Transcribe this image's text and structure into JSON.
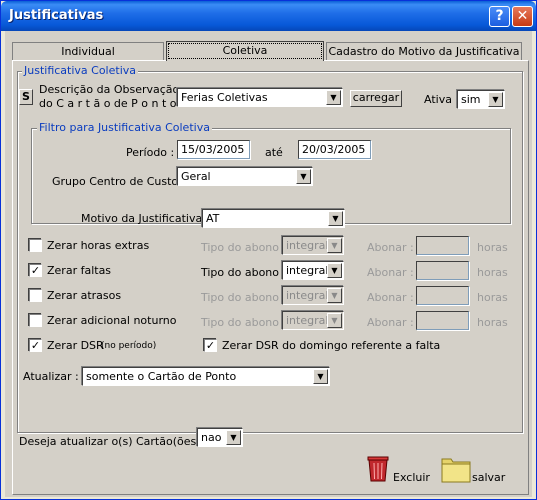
{
  "window": {
    "title": "Justificativas",
    "help_label": "?",
    "close_label": "✕"
  },
  "tabs": [
    {
      "label": "Individual"
    },
    {
      "label": "Coletiva"
    },
    {
      "label": "Cadastro do Motivo da Justificativa"
    }
  ],
  "justificativa_coletiva": {
    "legend": "Justificativa Coletiva",
    "s_icon_label": "S",
    "descricao_label_line1": "Descrição da Observação",
    "descricao_label_line2": "do C a r t ã o  de  P o n t o :",
    "descricao_value": "Ferias Coletivas",
    "carregar_label": "carregar",
    "ativa_label": "Ativa :",
    "ativa_value": "sim"
  },
  "filtro": {
    "legend": "Filtro para Justificativa Coletiva",
    "periodo_label": "Período :",
    "periodo_inicio": "15/03/2005",
    "ate_label": "até",
    "periodo_fim": "20/03/2005",
    "grupo_label": "Grupo Centro de Custo :",
    "grupo_value": "Geral"
  },
  "motivo": {
    "label": "Motivo da Justificativa :",
    "value": "AT"
  },
  "rows": [
    {
      "label": "Zerar horas extras",
      "checked": false,
      "enabled": false,
      "tipo_label": "Tipo do abono :",
      "tipo_value": "integral",
      "abonar_label": "Abonar :",
      "abonar_value": "",
      "horas_label": "horas"
    },
    {
      "label": "Zerar faltas",
      "checked": true,
      "enabled": true,
      "tipo_label": "Tipo do abono :",
      "tipo_value": "integral",
      "abonar_label": "Abonar :",
      "abonar_value": "",
      "horas_label": "horas"
    },
    {
      "label": "Zerar atrasos",
      "checked": false,
      "enabled": false,
      "tipo_label": "Tipo do abono :",
      "tipo_value": "integral",
      "abonar_label": "Abonar :",
      "abonar_value": "",
      "horas_label": "horas"
    },
    {
      "label": "Zerar adicional noturno",
      "checked": false,
      "enabled": false,
      "tipo_label": "Tipo do abono :",
      "tipo_value": "integral",
      "abonar_label": "Abonar :",
      "abonar_value": "",
      "horas_label": "horas"
    }
  ],
  "zerar_dsr": {
    "label": "Zerar DSR",
    "sub_label": "(no período)",
    "checked": true
  },
  "zerar_dsr_domingo": {
    "label": "Zerar DSR do domingo referente a falta",
    "checked": true
  },
  "atualizar": {
    "label": "Atualizar :",
    "value": "somente o Cartão de Ponto"
  },
  "deseja": {
    "label": "Deseja atualizar o(s) Cartão(ões) ?",
    "value": "nao"
  },
  "actions": {
    "excluir_label": "Excluir",
    "salvar_label": "salvar"
  },
  "colors": {
    "title_bar": "#0a5fd6",
    "legend": "#0a3cbf",
    "face": "#d4d0c8"
  }
}
